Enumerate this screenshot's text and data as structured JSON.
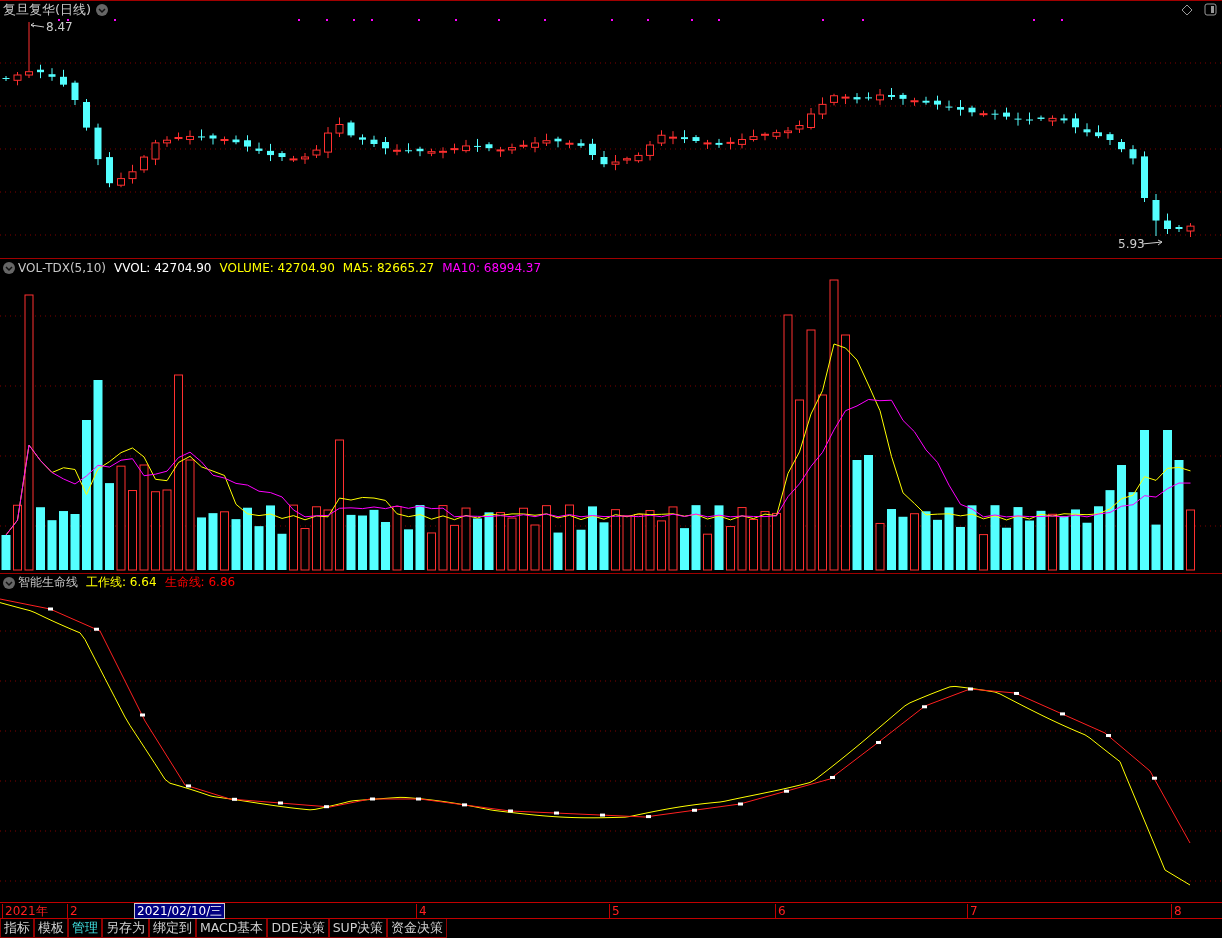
{
  "title": "复旦复华(日线)",
  "price_panel": {
    "high_label": "8.47",
    "low_label": "5.93"
  },
  "volume_panel": {
    "name": "VOL-TDX(5,10)",
    "items": [
      {
        "label": "VVOL: 42704.90",
        "color": "#ffffff"
      },
      {
        "label": "VOLUME: 42704.90",
        "color": "#ffff00"
      },
      {
        "label": "MA5: 82665.27",
        "color": "#ffff00"
      },
      {
        "label": "MA10: 68994.37",
        "color": "#ff00ff"
      }
    ]
  },
  "indicator_panel": {
    "name": "智能生命线",
    "items": [
      {
        "label": "工作线: 6.64",
        "color": "#ffff00"
      },
      {
        "label": "生命线: 6.86",
        "color": "#ff0000"
      }
    ]
  },
  "time_axis": [
    {
      "label": "2021年",
      "selected": false
    },
    {
      "label": "2",
      "selected": false
    },
    {
      "label": "2021/02/10/三",
      "selected": true
    },
    {
      "label": "4",
      "selected": false
    },
    {
      "label": "5",
      "selected": false
    },
    {
      "label": "6",
      "selected": false
    },
    {
      "label": "7",
      "selected": false
    },
    {
      "label": "8",
      "selected": false
    }
  ],
  "tabs": [
    {
      "label": "指标",
      "selected": false
    },
    {
      "label": "模板",
      "selected": false
    },
    {
      "label": "管理",
      "selected": true
    },
    {
      "label": "另存为",
      "selected": false
    },
    {
      "label": "绑定到",
      "selected": false
    },
    {
      "label": "MACD基本",
      "selected": false
    },
    {
      "label": "DDE决策",
      "selected": false
    },
    {
      "label": "SUP决策",
      "selected": false
    },
    {
      "label": "资金决策",
      "selected": false
    }
  ]
}
